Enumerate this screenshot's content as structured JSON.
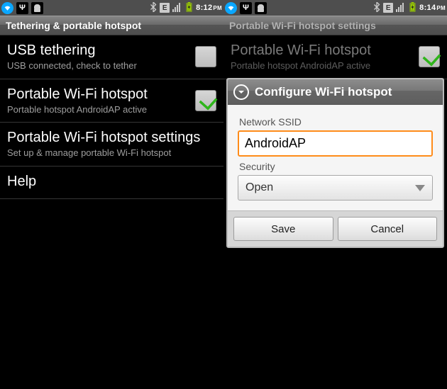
{
  "left": {
    "clock": "8:12",
    "ampm": "PM",
    "header": "Tethering & portable hotspot",
    "items": [
      {
        "title": "USB tethering",
        "sub": "USB connected, check to tether",
        "checked": false,
        "hasCheck": true
      },
      {
        "title": "Portable Wi-Fi hotspot",
        "sub": "Portable hotspot AndroidAP active",
        "checked": true,
        "hasCheck": true
      },
      {
        "title": "Portable Wi-Fi hotspot settings",
        "sub": "Set up & manage portable Wi-Fi hotspot",
        "hasCheck": false
      },
      {
        "title": "Help",
        "sub": "",
        "hasCheck": false
      }
    ]
  },
  "right": {
    "clock": "8:14",
    "ampm": "PM",
    "header": "Portable Wi-Fi hotspot settings",
    "bgItems": [
      {
        "title": "Portable Wi-Fi hotspot",
        "sub": "Portable hotspot AndroidAP active",
        "checked": true,
        "hasCheck": true
      }
    ],
    "dialog": {
      "title": "Configure Wi-Fi hotspot",
      "ssid_label": "Network SSID",
      "ssid_value": "AndroidAP",
      "security_label": "Security",
      "security_value": "Open",
      "save": "Save",
      "cancel": "Cancel"
    }
  }
}
